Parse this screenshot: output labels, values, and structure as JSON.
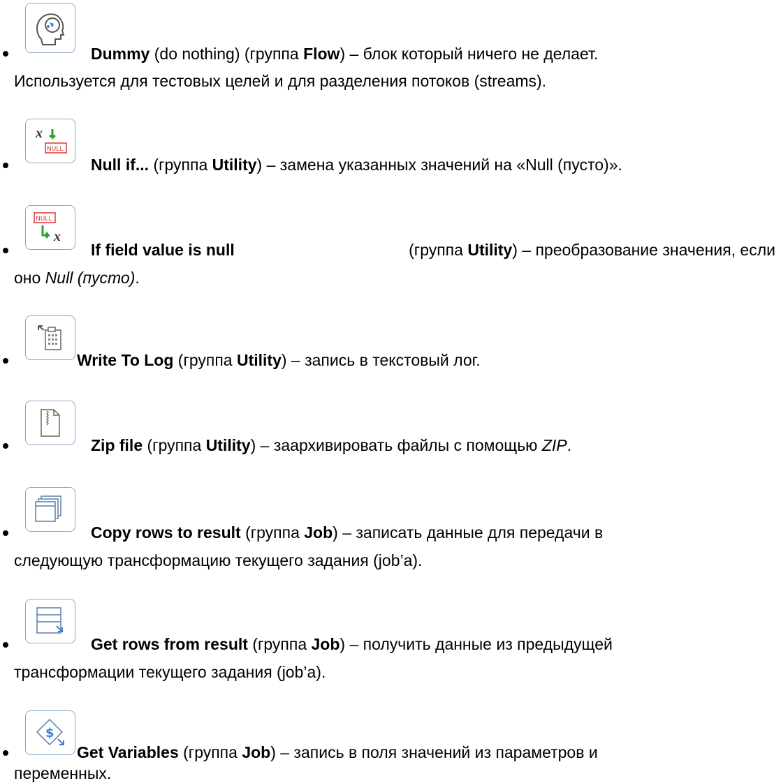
{
  "items": [
    {
      "icon": "dummy-brain-icon",
      "name": "Dummy",
      "pre": " (do nothing) (группа ",
      "group": "Flow",
      "desc": ") – блок который ничего не делает.",
      "line2": "Используется для тестовых целей и для разделения потоков (streams)."
    },
    {
      "icon": "null-if-icon",
      "name": "Null if...",
      "pre": " (группа ",
      "group": "Utility",
      "desc": ") – замена указанных значений на «Null (пусто)»."
    },
    {
      "icon": "if-field-null-icon",
      "name": "If field value is null",
      "pre": " (группа ",
      "group": "Utility",
      "desc": ") – преобразование значения, если",
      "line2_pre": "оно ",
      "line2_em": "Null (пусто)",
      "line2_post": "."
    },
    {
      "icon": "write-to-log-icon",
      "name": "Write To Log",
      "pre": " (группа ",
      "group": "Utility",
      "desc": ") – запись в текстовый лог."
    },
    {
      "icon": "zip-file-icon",
      "name": "Zip file",
      "pre": " (группа ",
      "group": "Utility",
      "desc": ") – заархивировать файлы с помощью ",
      "desc_em": "ZIP",
      "desc_post": "."
    },
    {
      "icon": "copy-rows-icon",
      "name": "Copy rows to result",
      "pre": " (группа ",
      "group": "Job",
      "desc": ") – записать данные для передачи в",
      "line2": "следующую трансформацию текущего задания (job’a)."
    },
    {
      "icon": "get-rows-icon",
      "name": "Get rows from result",
      "pre": " (группа ",
      "group": "Job",
      "desc": ") – получить данные из предыдущей",
      "line2": "трансформации текущего задания (job’a)."
    },
    {
      "icon": "get-variables-icon",
      "name": "Get Variables",
      "pre": " (группа ",
      "group": "Job",
      "desc": ") – запись в поля значений из параметров и",
      "line2": "переменных."
    }
  ]
}
